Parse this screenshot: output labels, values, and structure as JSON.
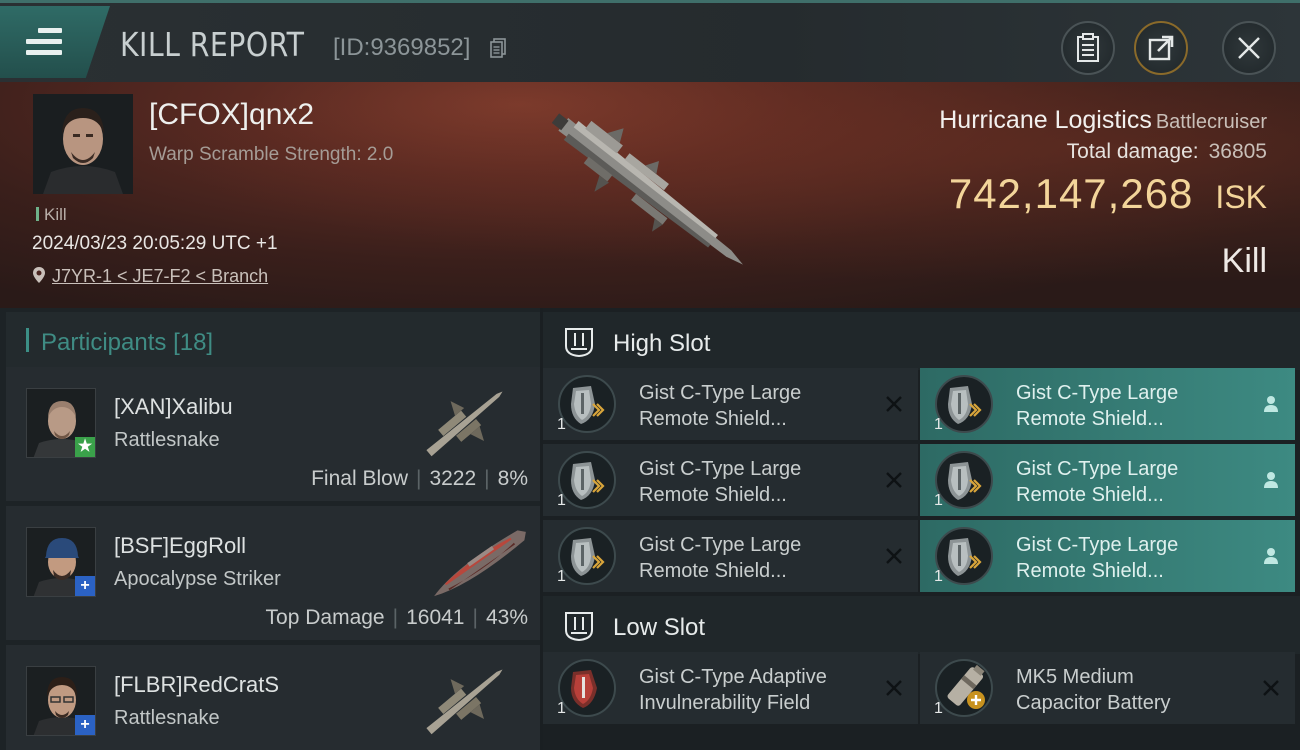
{
  "header": {
    "title": "KILL REPORT",
    "report_id": "[ID:9369852]"
  },
  "victim": {
    "name": "[CFOX]qnx2",
    "subtitle": "Warp Scramble Strength: 2.0",
    "kill_tag": "Kill",
    "time": "2024/03/23 20:05:29 UTC +1",
    "location": "J7YR-1 < JE7-F2 < Branch",
    "ship_name": "Hurricane Logistics",
    "ship_class": "Battlecruiser",
    "damage_label": "Total damage:",
    "damage_value": "36805",
    "isk_value": "742,147,268",
    "isk_unit": "ISK",
    "result": "Kill"
  },
  "participants": {
    "label": "Participants",
    "count": "[18]",
    "rows": [
      {
        "name": "[XAN]Xalibu",
        "ship": "Rattlesnake",
        "role": "Final Blow",
        "damage": "3222",
        "percent": "8%",
        "badge": "★",
        "badge_color": "#3aa14a"
      },
      {
        "name": "[BSF]EggRoll",
        "ship": "Apocalypse Striker",
        "role": "Top Damage",
        "damage": "16041",
        "percent": "43%",
        "badge": "+",
        "badge_color": "#2b62c4"
      },
      {
        "name": "[FLBR]RedCratS",
        "ship": "Rattlesnake",
        "role": "",
        "damage": "",
        "percent": "",
        "badge": "+",
        "badge_color": "#2b62c4"
      }
    ]
  },
  "fitting": {
    "high_slot_label": "High Slot",
    "low_slot_label": "Low Slot",
    "high_modules": [
      {
        "name_line1": "Gist C-Type Large",
        "name_line2": "Remote Shield...",
        "qty": "1",
        "highlighted": false,
        "action_icon": "close-icon"
      },
      {
        "name_line1": "Gist C-Type Large",
        "name_line2": "Remote Shield...",
        "qty": "1",
        "highlighted": true,
        "action_icon": "person-icon"
      },
      {
        "name_line1": "Gist C-Type Large",
        "name_line2": "Remote Shield...",
        "qty": "1",
        "highlighted": false,
        "action_icon": "close-icon"
      },
      {
        "name_line1": "Gist C-Type Large",
        "name_line2": "Remote Shield...",
        "qty": "1",
        "highlighted": true,
        "action_icon": "person-icon"
      },
      {
        "name_line1": "Gist C-Type Large",
        "name_line2": "Remote Shield...",
        "qty": "1",
        "highlighted": false,
        "action_icon": "close-icon"
      },
      {
        "name_line1": "Gist C-Type Large",
        "name_line2": "Remote Shield...",
        "qty": "1",
        "highlighted": true,
        "action_icon": "person-icon"
      }
    ],
    "low_modules": [
      {
        "name_line1": "Gist C-Type Adaptive",
        "name_line2": "Invulnerability Field",
        "qty": "1",
        "highlighted": false,
        "action_icon": "close-icon"
      },
      {
        "name_line1": "MK5 Medium",
        "name_line2": "Capacitor Battery",
        "qty": "1",
        "highlighted": false,
        "action_icon": "close-icon"
      }
    ]
  },
  "colors": {
    "accent_teal": "#3d8a82",
    "isk_gold": "#f3d59a",
    "banner_red": "#5a2a22"
  }
}
